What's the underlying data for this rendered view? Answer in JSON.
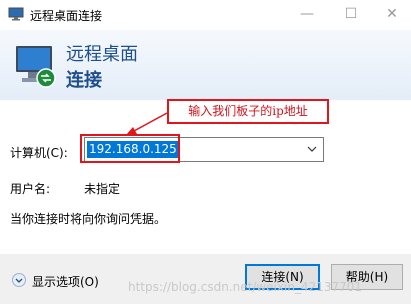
{
  "window": {
    "title": "远程桌面连接",
    "minimize": "—",
    "maximize": "☐",
    "close": "✕",
    "icons": [
      "remote-desktop-app-icon",
      "minimize-icon",
      "maximize-icon",
      "close-icon"
    ]
  },
  "banner": {
    "line1": "远程桌面",
    "line2": "连接",
    "icon": "remote-desktop-monitor-icon"
  },
  "annotation": {
    "text": "输入我们板子的ip地址",
    "color": "#e0161d"
  },
  "form": {
    "computer_label": "计算机(C):",
    "computer_value": "192.168.0.125",
    "username_label": "用户名:",
    "username_value": "未指定",
    "info_text": "当你连接时将向你询问凭据。"
  },
  "footer": {
    "options_label": "显示选项(O)",
    "connect_label": "连接(N)",
    "help_label": "帮助(H)"
  },
  "watermark": "https://blog.csdn.net/weixin_42137701",
  "colors": {
    "accent": "#0078d7",
    "banner_text": "#1f4e8c"
  }
}
